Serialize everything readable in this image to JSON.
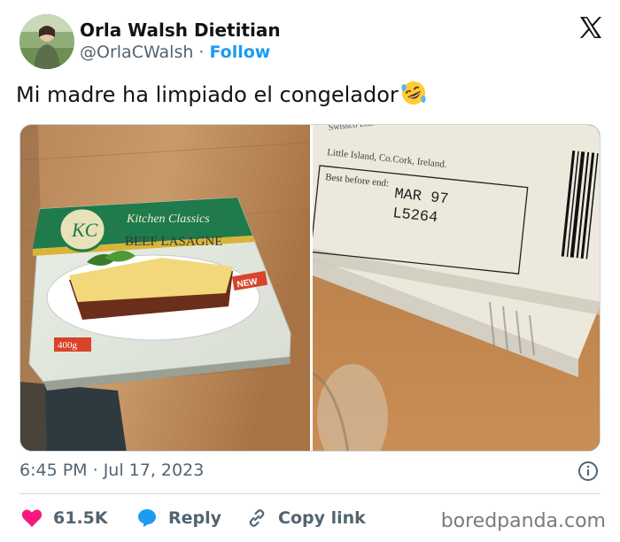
{
  "author": {
    "name": "Orla Walsh Dietitian",
    "handle": "@OrlaCWalsh",
    "separator": "·",
    "follow_label": "Follow"
  },
  "logo_icon": "x-logo-icon",
  "tweet": {
    "text": "Mi madre ha limpiado el congelador",
    "emoji": "rolling-on-floor-laughing-emoji"
  },
  "photo_left": {
    "brand": "Kitchen Classics",
    "product": "BEEF LASAGNE",
    "badge": "NEW",
    "weight": "400g"
  },
  "photo_right": {
    "address_line1": "Swissco Ltd.",
    "address_line2": "Little Island, Co.Cork, Ireland.",
    "best_before_label": "Best before end:",
    "date_code": "MAR  97",
    "lot_code": "L5264"
  },
  "meta": {
    "time": "6:45 PM",
    "separator": "·",
    "date": "Jul 17, 2023"
  },
  "actions": {
    "like_count": "61.5K",
    "reply_label": "Reply",
    "copy_label": "Copy link"
  },
  "colors": {
    "like": "#f91880",
    "reply": "#1d9bf0",
    "link": "#1d9bf0",
    "text": "#0f1419",
    "secondary": "#536471"
  },
  "watermark": "boredpanda.com"
}
